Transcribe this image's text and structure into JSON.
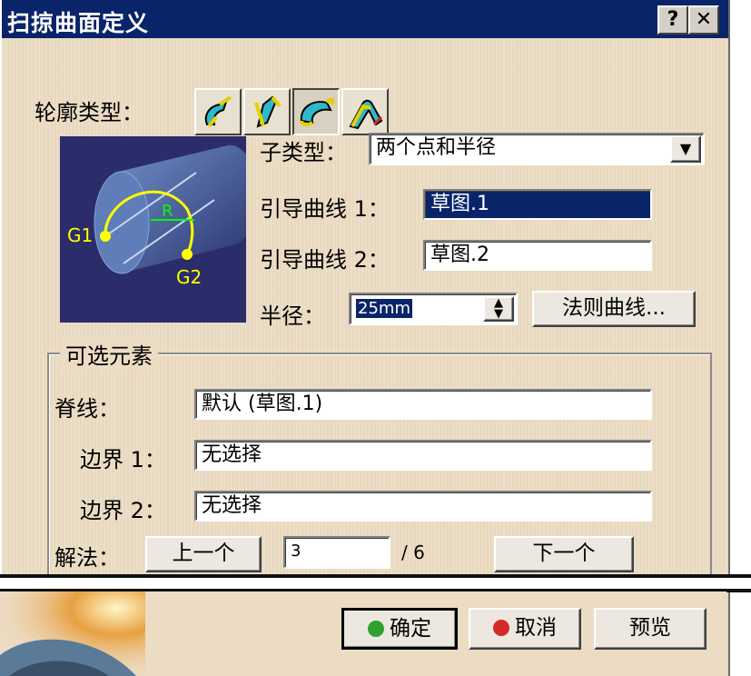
{
  "window": {
    "title": "扫掠曲面定义",
    "help_label": "?",
    "close_label": "✕"
  },
  "profile_type": {
    "label": "轮廓类型：",
    "buttons": [
      "type-1",
      "type-2",
      "type-3",
      "type-4"
    ],
    "active_index": 2
  },
  "preview": {
    "g1": "G1",
    "g2": "G2",
    "r": "R"
  },
  "subtype": {
    "label": "子类型：",
    "value": "两个点和半径"
  },
  "guide1": {
    "label": "引导曲线 1：",
    "value": "草图.1"
  },
  "guide2": {
    "label": "引导曲线 2：",
    "value": "草图.2"
  },
  "radius": {
    "label": "半径：",
    "value": "25mm",
    "law_button": "法则曲线..."
  },
  "optional": {
    "title": "可选元素",
    "spine_label": "脊线：",
    "spine_value": "默认 (草图.1)",
    "boundary1_label": "边界 1：",
    "boundary1_value": "无选择",
    "boundary2_label": "边界 2：",
    "boundary2_value": "无选择",
    "solution_label": "解法：",
    "prev_button": "上一个",
    "solution_value": "3",
    "solution_total": "/ 6",
    "next_button": "下一个"
  },
  "footer": {
    "ok": "确定",
    "cancel": "取消",
    "preview": "预览"
  },
  "colors": {
    "titlebar": "#0a246a",
    "dialog": "#ecdcc4",
    "ok": "#2fa12f",
    "cancel": "#d42a2a"
  }
}
